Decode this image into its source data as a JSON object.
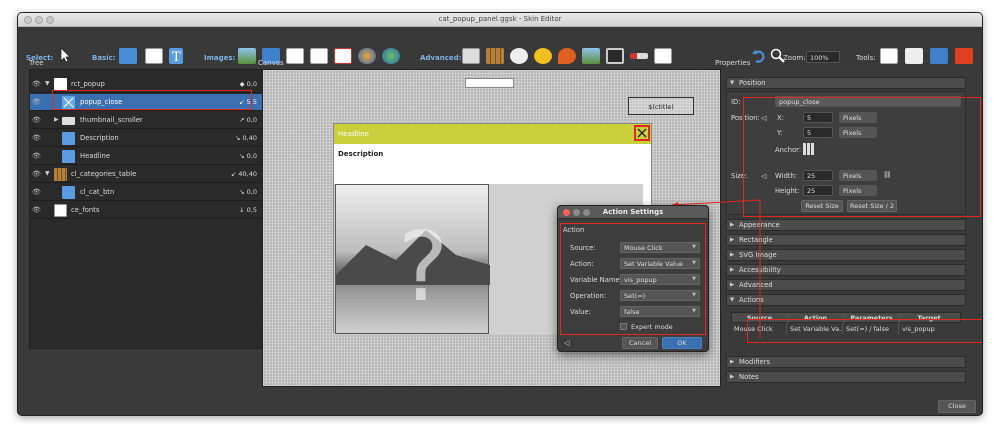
{
  "window": {
    "title": "cat_popup_panel.ggsk - Skin Editor"
  },
  "toolbar": {
    "select_label": "Select:",
    "basic_label": "Basic:",
    "images_label": "Images:",
    "advanced_label": "Advanced:",
    "zoom_label": "Zoom:",
    "zoom_value": "100%",
    "tools_label": "Tools:"
  },
  "panels": {
    "tree": "Tree",
    "canvas": "Canvas",
    "properties": "Properties"
  },
  "tree": {
    "rows": [
      {
        "name": "rct_popup",
        "value": "◆ 0,0"
      },
      {
        "name": "popup_close",
        "value": "↙ 5,5"
      },
      {
        "name": "thumbnail_scroller",
        "value": "↗ 0,0"
      },
      {
        "name": "Description",
        "value": "↘ 0,40"
      },
      {
        "name": "Headline",
        "value": "↘ 0,0"
      },
      {
        "name": "cl_categories_table",
        "value": "↙ 40,40"
      },
      {
        "name": "cl_cat_btn",
        "value": "↘ 0,0"
      },
      {
        "name": "ce_fonts",
        "value": "↓ 0,5"
      }
    ]
  },
  "canvas": {
    "ctitle": "$(ctitle)",
    "headline": "Headline",
    "description": "Description",
    "headline_color": "#c8cf3a"
  },
  "properties": {
    "position_section": "Position",
    "id_label": "ID:",
    "id_value": "popup_close",
    "position_label": "Position:",
    "x_label": "X:",
    "x_value": "5",
    "y_label": "Y:",
    "y_value": "5",
    "unit": "Pixels",
    "anchor_label": "Anchor:",
    "size_label": "Size:",
    "width_label": "Width:",
    "width_value": "25",
    "height_label": "Height:",
    "height_value": "25",
    "reset_size": "Reset Size",
    "reset_size_half": "Reset Size / 2",
    "sections": {
      "appearance": "Appearance",
      "rectangle": "Rectangle",
      "svg_image": "SVG Image",
      "accessibility": "Accessibility",
      "advanced": "Advanced",
      "actions": "Actions",
      "modifiers": "Modifiers",
      "notes": "Notes"
    },
    "actions_table": {
      "headers": [
        "Source",
        "Action",
        "Parameters",
        "Target"
      ],
      "row": [
        "Mouse Click",
        "Set Variable Va...",
        "Set(=) / false",
        "vis_popup"
      ]
    }
  },
  "dialog": {
    "title": "Action Settings",
    "group": "Action",
    "source_label": "Source:",
    "source_value": "Mouse Click",
    "action_label": "Action:",
    "action_value": "Set Variable Value",
    "varname_label": "Variable Name:",
    "varname_value": "vis_popup",
    "operation_label": "Operation:",
    "operation_value": "Set(=)",
    "value_label": "Value:",
    "value_value": "false",
    "expert_mode": "Expert mode",
    "cancel": "Cancel",
    "ok": "OK"
  },
  "footer": {
    "close": "Close"
  },
  "colors": {
    "accent_red": "#e0281e",
    "selection_blue": "#3a6fb0"
  }
}
